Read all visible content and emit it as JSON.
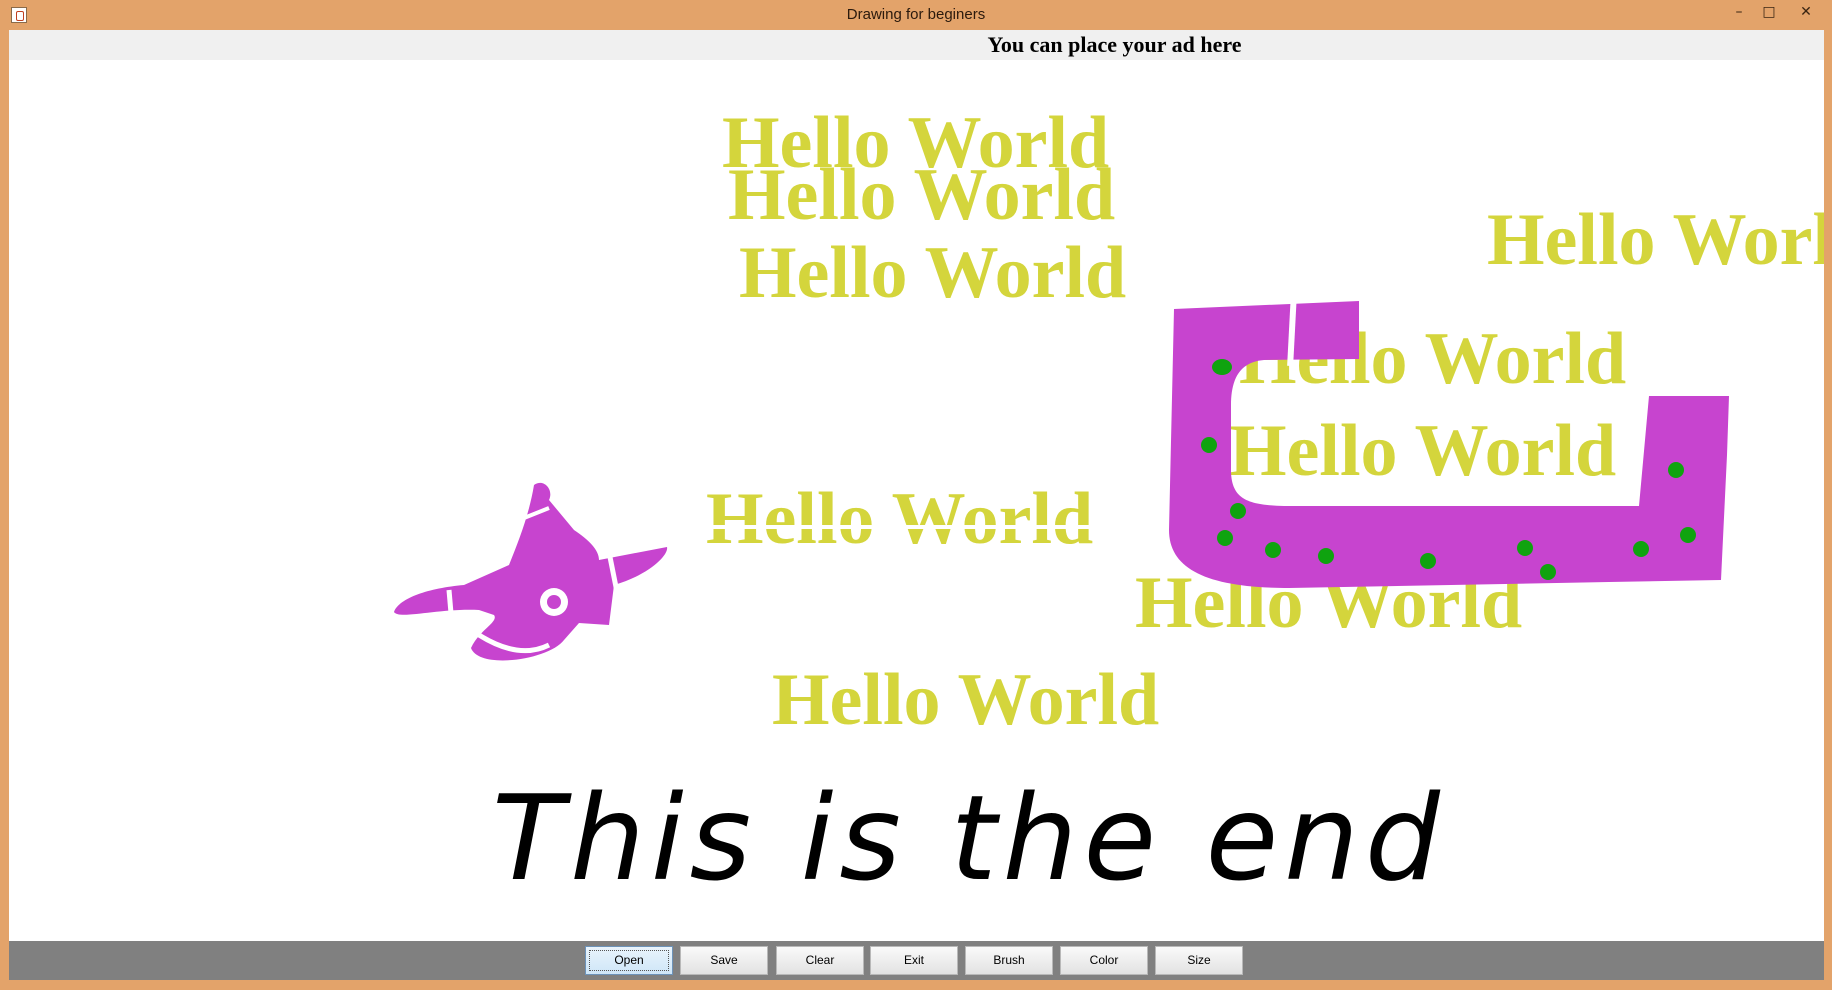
{
  "window": {
    "title": "Drawing for beginers",
    "minimize_glyph": "–",
    "maximize_glyph": "□",
    "close_glyph": "✕",
    "frame_color": "#e3a36a"
  },
  "ad_banner": {
    "text": "You can place your ad here"
  },
  "canvas": {
    "stamp_text": "Hello World",
    "stamp_color": "#d4d53c",
    "brush_color": "#c744cf",
    "dot_color": "#0fa30f",
    "ink_color": "#000000",
    "handwriting": "This is the end"
  },
  "toolbar": {
    "open": "Open",
    "save": "Save",
    "clear": "Clear",
    "exit": "Exit",
    "brush": "Brush",
    "color": "Color",
    "size": "Size"
  }
}
